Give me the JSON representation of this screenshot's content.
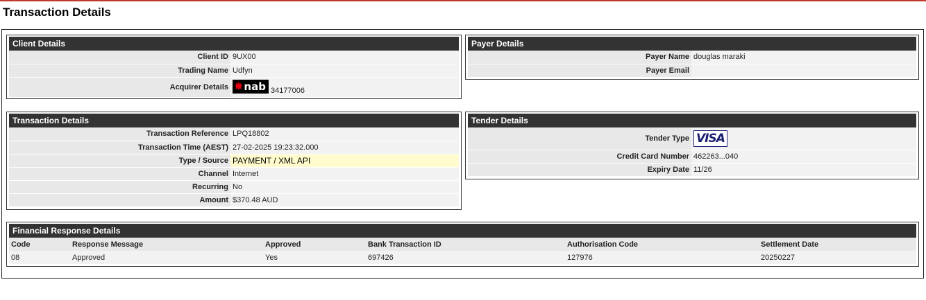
{
  "page_title": "Transaction Details",
  "client": {
    "header": "Client Details",
    "client_id_label": "Client ID",
    "client_id": "9UX00",
    "trading_name_label": "Trading Name",
    "trading_name": "Udfyn",
    "acquirer_label": "Acquirer Details",
    "acquirer_logo_text": "nab",
    "acquirer_id": "34177006"
  },
  "payer": {
    "header": "Payer Details",
    "name_label": "Payer Name",
    "name": "douglas maraki",
    "email_label": "Payer Email",
    "email": ""
  },
  "transaction": {
    "header": "Transaction Details",
    "reference_label": "Transaction Reference",
    "reference": "LPQ18802",
    "time_label": "Transaction Time (AEST)",
    "time": "27-02-2025 19:23:32.000",
    "type_label": "Type / Source",
    "type": "PAYMENT / XML API",
    "channel_label": "Channel",
    "channel": "Internet",
    "recurring_label": "Recurring",
    "recurring": "No",
    "amount_label": "Amount",
    "amount": "$370.48 AUD"
  },
  "tender": {
    "header": "Tender Details",
    "type_label": "Tender Type",
    "type_logo_text": "VISA",
    "card_label": "Credit Card Number",
    "card": "462263...040",
    "expiry_label": "Expiry Date",
    "expiry": "11/26"
  },
  "financial": {
    "header": "Financial Response Details",
    "columns": [
      "Code",
      "Response Message",
      "Approved",
      "Bank Transaction ID",
      "Authorisation Code",
      "Settlement Date"
    ],
    "rows": [
      [
        "08",
        "Approved",
        "Yes",
        "697426",
        "127976",
        "20250227"
      ]
    ]
  },
  "colors": {
    "accent_line": "#c0392b",
    "header_bg": "#333333",
    "highlight": "#fffbcc"
  }
}
